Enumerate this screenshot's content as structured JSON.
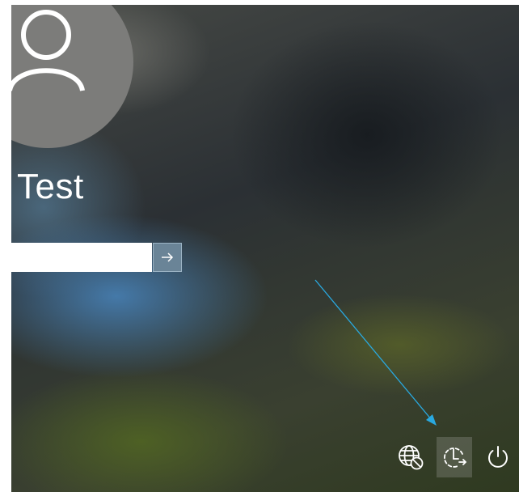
{
  "user": {
    "name": "Test",
    "avatar_icon": "user-silhouette-icon"
  },
  "password": {
    "value": "",
    "placeholder": ""
  },
  "submit": {
    "icon": "arrow-right-icon"
  },
  "tray": {
    "buttons": [
      {
        "icon": "network-disconnected-icon",
        "active": false
      },
      {
        "icon": "ease-of-access-icon",
        "active": true
      },
      {
        "icon": "power-icon",
        "active": false
      }
    ]
  },
  "annotation": {
    "color": "#29a9e0",
    "points_to": "ease-of-access-icon"
  }
}
